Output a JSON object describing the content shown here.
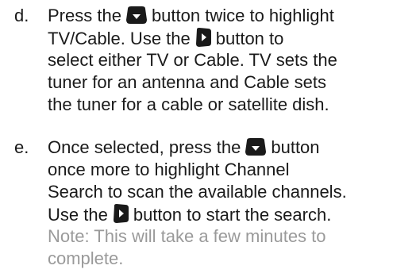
{
  "steps": [
    {
      "marker": "d.",
      "lines": [
        [
          "Press the",
          "button twice to highlight"
        ],
        [
          "TV/Cable.  Use the",
          "button to"
        ],
        [
          "select either TV or Cable.  TV sets the"
        ],
        [
          "tuner for an antenna and Cable sets"
        ],
        [
          "the tuner for a cable or satellite dish."
        ]
      ],
      "icons": [
        "down-arrow-button-icon",
        "right-arrow-button-icon"
      ]
    },
    {
      "marker": "e.",
      "lines": [
        [
          "Once selected, press the",
          "button"
        ],
        [
          "once more to highlight Channel"
        ],
        [
          "Search to scan the available channels."
        ],
        [
          "Use the",
          "button to start the search."
        ]
      ],
      "note": [
        "Note: This will take a few minutes to",
        "complete."
      ],
      "icons": [
        "down-arrow-button-icon",
        "right-arrow-button-icon"
      ]
    }
  ],
  "colors": {
    "text": "#1a1a1a",
    "note": "#9a9a9a",
    "button_icon": "#1a1a1a"
  }
}
